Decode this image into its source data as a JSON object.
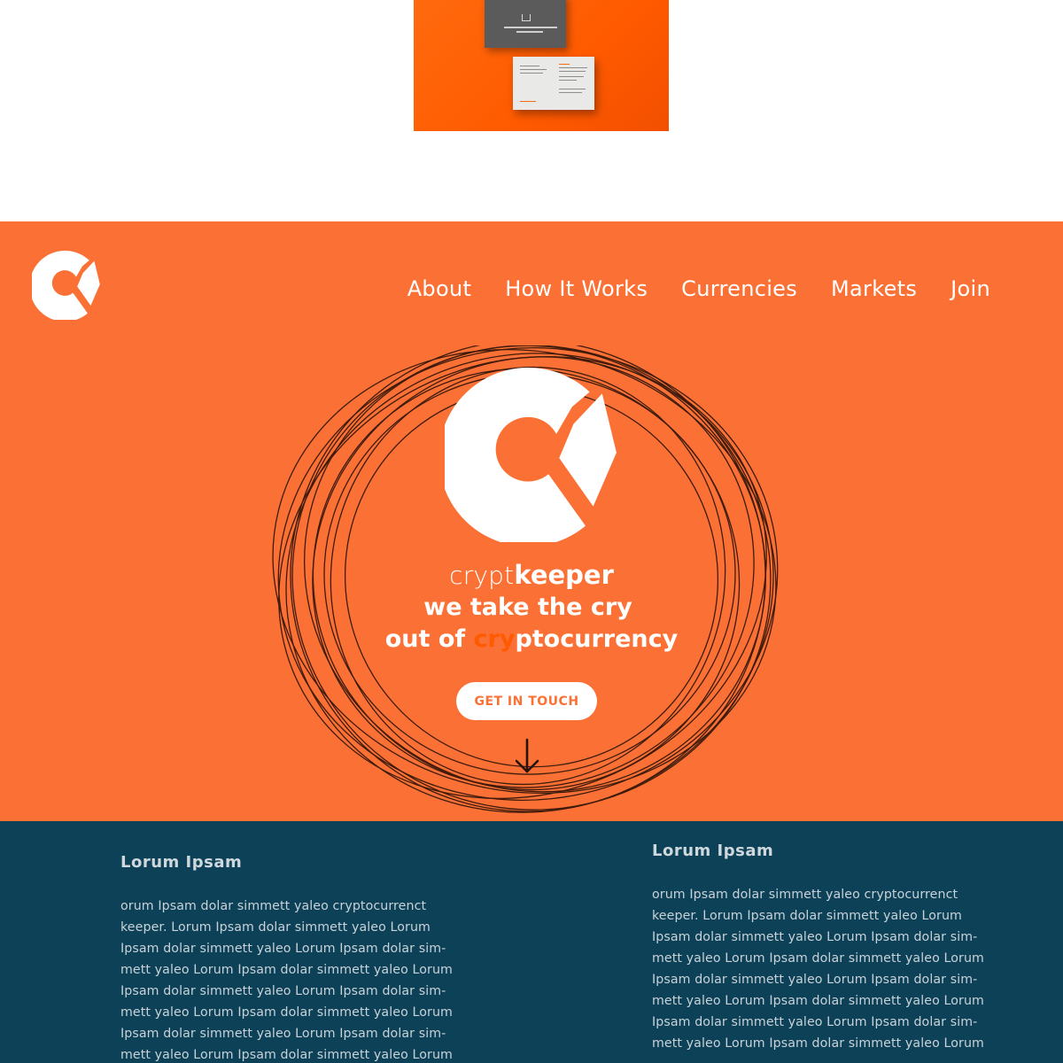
{
  "nav": {
    "items": [
      "About",
      "How It Works",
      "Currencies",
      "Markets",
      "Join"
    ]
  },
  "hero": {
    "brand_light": "crypt",
    "brand_bold": "keeper",
    "tagline_line1": "we take the cry",
    "tagline_line2_pre": "out of ",
    "tagline_line2_highlight": "cry",
    "tagline_line2_post": "ptocurrency",
    "cta_label": "GET IN TOUCH"
  },
  "info": {
    "left": {
      "heading": "Lorum Ipsam",
      "body": "orum Ipsam dolar simmett yaleo cryptocurrenct keeper. Lorum Ipsam dolar simmett yaleo Lorum Ipsam dolar simmett yaleo Lorum Ipsam dolar sim-mett yaleo Lorum Ipsam dolar simmett yaleo Lorum Ipsam dolar simmett yaleo Lorum Ipsam dolar sim-mett yaleo Lorum Ipsam dolar simmett yaleo Lorum Ipsam dolar simmett yaleo Lorum Ipsam dolar sim-mett yaleo Lorum Ipsam dolar simmett yaleo Lorum"
    },
    "right": {
      "heading": "Lorum Ipsam",
      "body": "orum Ipsam dolar simmett yaleo cryptocurrenct keeper. Lorum Ipsam dolar simmett yaleo Lorum Ipsam dolar simmett yaleo Lorum Ipsam dolar sim-mett yaleo Lorum Ipsam dolar simmett yaleo Lorum Ipsam dolar simmett yaleo Lorum Ipsam dolar sim-mett yaleo Lorum Ipsam dolar simmett yaleo Lorum Ipsam dolar simmett yaleo Lorum Ipsam dolar sim-mett yaleo Lorum Ipsam dolar simmett yaleo Lorum"
    }
  },
  "colors": {
    "hero_bg": "#fb7135",
    "highlight": "#ff5a00",
    "info_bg": "#0d4157",
    "info_text": "#c8d2d8"
  },
  "icons": [
    "brand-logo-icon",
    "arrow-down-icon"
  ]
}
